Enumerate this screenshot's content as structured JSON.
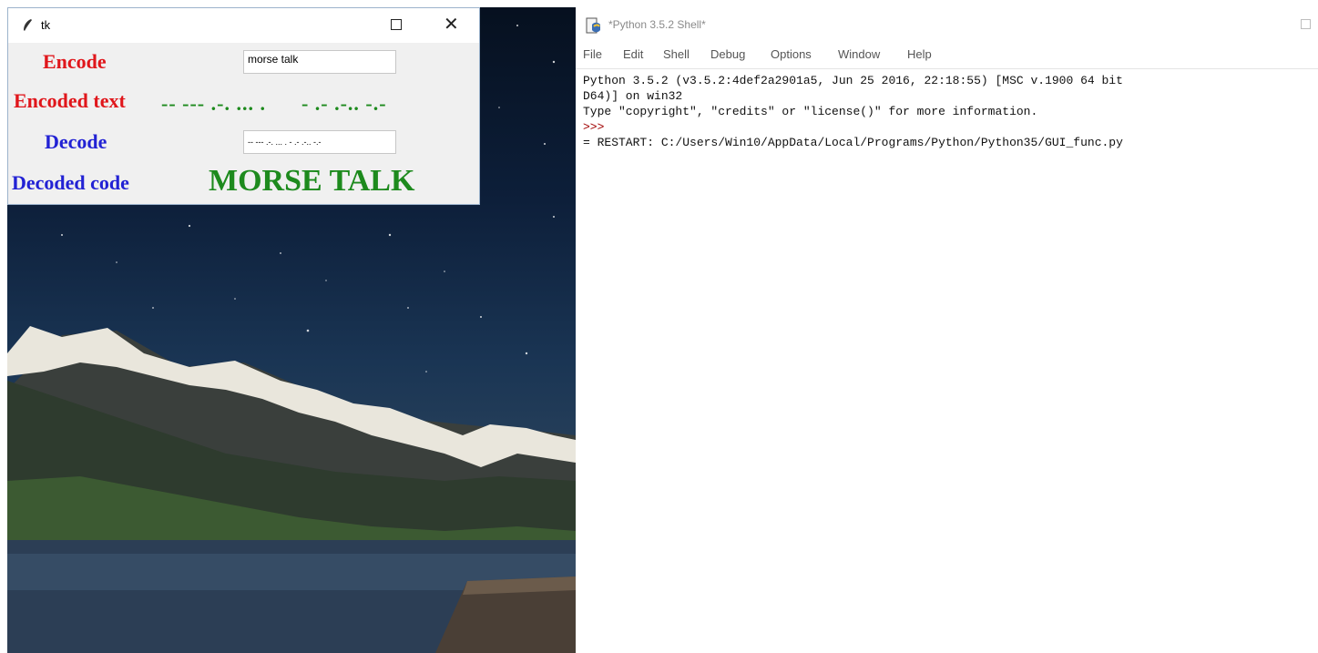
{
  "tk_window": {
    "title": "tk",
    "encode_label": "Encode",
    "encode_input_value": "morse talk",
    "encoded_text_label": "Encoded text",
    "encoded_text_value": "-- --- .-. ... .      - .- .-.. -.-",
    "decode_label": "Decode",
    "decode_input_value": "-- --- .-. ... .  - .- .-.. -.-",
    "decoded_code_label": "Decoded code",
    "decoded_code_value": "MORSE TALK",
    "colors": {
      "red": "#e0161b",
      "blue": "#2222d4",
      "green": "#1d8a1d"
    }
  },
  "shell": {
    "title": "*Python 3.5.2 Shell*",
    "menu": [
      "File",
      "Edit",
      "Shell",
      "Debug",
      "Options",
      "Window",
      "Help"
    ],
    "lines": [
      "Python 3.5.2 (v3.5.2:4def2a2901a5, Jun 25 2016, 22:18:55) [MSC v.1900 64 bit",
      "D64)] on win32",
      "Type \"copyright\", \"credits\" or \"license()\" for more information."
    ],
    "prompt": ">>>",
    "restart_line": "= RESTART: C:/Users/Win10/AppData/Local/Programs/Python/Python35/GUI_func.py"
  }
}
